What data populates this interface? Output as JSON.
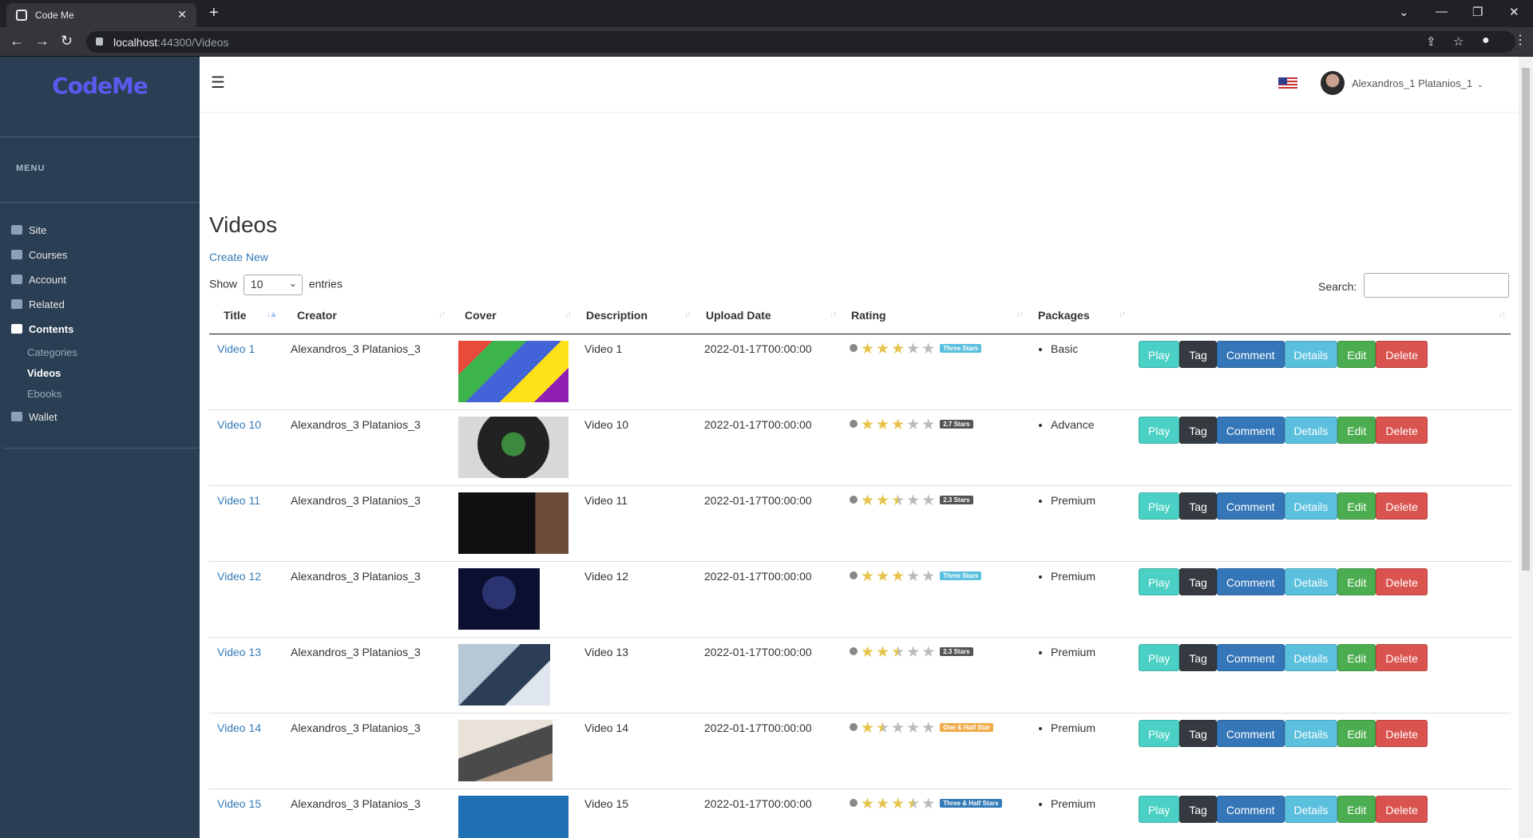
{
  "browser": {
    "tab_title": "Code Me",
    "url_host": "localhost",
    "url_rest": ":44300/Videos"
  },
  "sidebar": {
    "logo": "CodeMe",
    "menu_label": "MENU",
    "items": [
      {
        "label": "Site"
      },
      {
        "label": "Courses"
      },
      {
        "label": "Account"
      },
      {
        "label": "Related"
      },
      {
        "label": "Contents"
      },
      {
        "label": "Wallet"
      }
    ],
    "sub_items": [
      {
        "label": "Categories"
      },
      {
        "label": "Videos"
      },
      {
        "label": "Ebooks"
      }
    ]
  },
  "topnav": {
    "user_name": "Alexandros_1 Platanios_1"
  },
  "page": {
    "title": "Videos",
    "create_new": "Create New",
    "show_label": "Show",
    "show_value": "10",
    "entries_label": "entries",
    "search_label": "Search:",
    "search_value": ""
  },
  "table": {
    "headers": [
      "Title",
      "Creator",
      "Cover",
      "Description",
      "Upload Date",
      "Rating",
      "Packages",
      ""
    ],
    "buttons": {
      "play": "Play",
      "tag": "Tag",
      "comment": "Comment",
      "details": "Details",
      "edit": "Edit",
      "delete": "Delete"
    },
    "rows": [
      {
        "title": "Video 1",
        "creator": "Alexandros_3 Platanios_3",
        "description": "Video 1",
        "date": "2022-01-17T00:00:00",
        "rating": 3,
        "badge": "Three Stars",
        "badge_color": "#5bc0de",
        "package": "Basic"
      },
      {
        "title": "Video 10",
        "creator": "Alexandros_3 Platanios_3",
        "description": "Video 10",
        "date": "2022-01-17T00:00:00",
        "rating": 3,
        "badge": "2.7 Stars",
        "badge_color": "#555555",
        "package": "Advance"
      },
      {
        "title": "Video 11",
        "creator": "Alexandros_3 Platanios_3",
        "description": "Video 11",
        "date": "2022-01-17T00:00:00",
        "rating": 2.5,
        "badge": "2.3 Stars",
        "badge_color": "#555555",
        "package": "Premium"
      },
      {
        "title": "Video 12",
        "creator": "Alexandros_3 Platanios_3",
        "description": "Video 12",
        "date": "2022-01-17T00:00:00",
        "rating": 3,
        "badge": "Three Stars",
        "badge_color": "#5bc0de",
        "package": "Premium"
      },
      {
        "title": "Video 13",
        "creator": "Alexandros_3 Platanios_3",
        "description": "Video 13",
        "date": "2022-01-17T00:00:00",
        "rating": 2.5,
        "badge": "2.3 Stars",
        "badge_color": "#555555",
        "package": "Premium"
      },
      {
        "title": "Video 14",
        "creator": "Alexandros_3 Platanios_3",
        "description": "Video 14",
        "date": "2022-01-17T00:00:00",
        "rating": 1.5,
        "badge": "One & Half Star",
        "badge_color": "#f0ad4e",
        "package": "Premium"
      },
      {
        "title": "Video 15",
        "creator": "Alexandros_3 Platanios_3",
        "description": "Video 15",
        "date": "2022-01-17T00:00:00",
        "rating": 3.5,
        "badge": "Three & Half Stars",
        "badge_color": "#337ab7",
        "package": "Premium"
      }
    ]
  },
  "colors": {
    "sidebar_bg": "#2a3f54",
    "logo": "#5a5af0",
    "link": "#337ab7"
  }
}
